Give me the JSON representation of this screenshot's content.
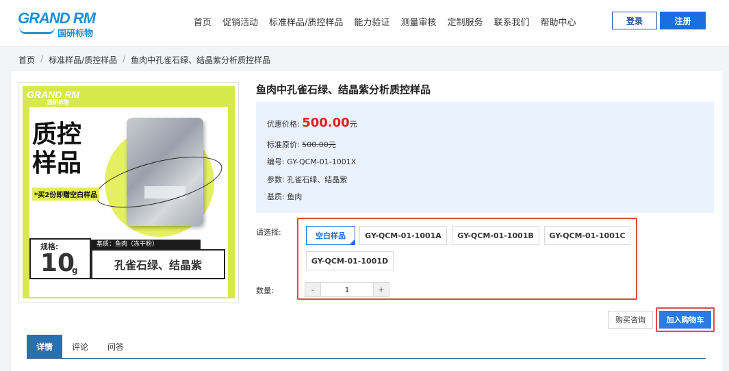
{
  "header": {
    "logo_text": "GRAND RM",
    "logo_sub": "国研标物",
    "nav": [
      "首页",
      "促销活动",
      "标准样品/质控样品",
      "能力验证",
      "测量审核",
      "定制服务",
      "联系我们",
      "帮助中心"
    ],
    "login_label": "登录",
    "register_label": "注册"
  },
  "breadcrumb": {
    "items": [
      "首页",
      "标准样品/质控样品",
      "鱼肉中孔雀石绿、结晶紫分析质控样品"
    ],
    "separator": "/"
  },
  "product_image": {
    "logo": "GRAND RM",
    "logo_sub": "国研标物",
    "title_line1": "质控",
    "title_line2": "样品",
    "promo": "*买2份即赠空白样品",
    "spec_label": "规格:",
    "spec_value": "10",
    "spec_unit": "g",
    "base_label": "基质：鱼肉（冻干粉）",
    "name": "孔雀石绿、结晶紫"
  },
  "product": {
    "title": "鱼肉中孔雀石绿、结晶紫分析质控样品",
    "price_label": "优惠价格:",
    "price_value": "500.00",
    "price_unit": "元",
    "orig_label": "标准原价:",
    "orig_value": "500.00元",
    "code_label": "编号:",
    "code_value": "GY-QCM-01-1001X",
    "param_label": "参数:",
    "param_value": "孔雀石绿、结晶紫",
    "base_label": "基质:",
    "base_value": "鱼肉"
  },
  "selection": {
    "select_label": "请选择:",
    "options": [
      "空白样品",
      "GY-QCM-01-1001A",
      "GY-QCM-01-1001B",
      "GY-QCM-01-1001C",
      "GY-QCM-01-1001D"
    ],
    "selected": "空白样品",
    "qty_label": "数量:",
    "qty_minus": "-",
    "qty_value": "1",
    "qty_plus": "+"
  },
  "actions": {
    "consult_label": "购买咨询",
    "cart_label": "加入购物车"
  },
  "tabs": [
    "详情",
    "评论",
    "问答"
  ],
  "colors": {
    "primary": "#1a6fe0",
    "price": "#e02020",
    "highlight": "#e04a44",
    "info_bg": "#eaf2fd"
  }
}
